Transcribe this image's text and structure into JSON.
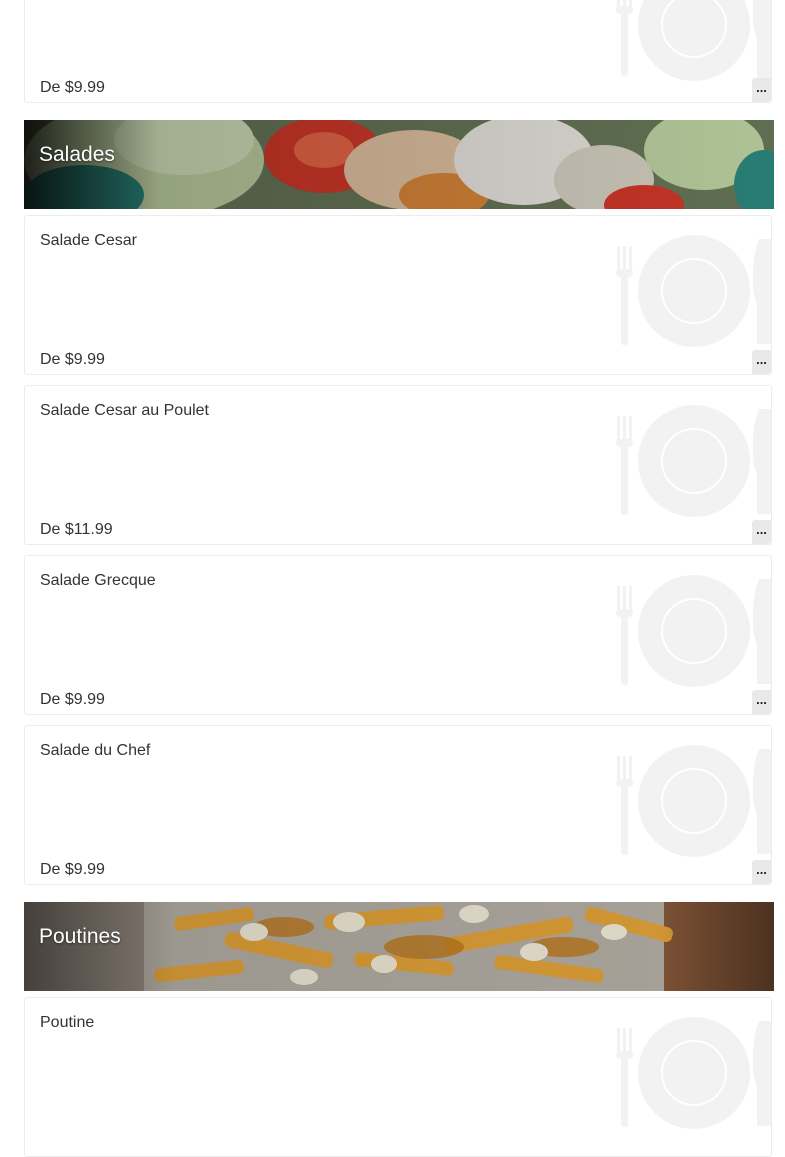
{
  "top_item": {
    "price": "De $9.99",
    "more_label": "..."
  },
  "sections": [
    {
      "title": "Salades",
      "items": [
        {
          "name": "Salade Cesar",
          "price": "De $9.99",
          "more_label": "..."
        },
        {
          "name": "Salade Cesar au Poulet",
          "price": "De $11.99",
          "more_label": "..."
        },
        {
          "name": "Salade Grecque",
          "price": "De $9.99",
          "more_label": "..."
        },
        {
          "name": "Salade du Chef",
          "price": "De $9.99",
          "more_label": "..."
        }
      ]
    },
    {
      "title": "Poutines",
      "items": [
        {
          "name": "Poutine",
          "price": "",
          "more_label": ""
        }
      ]
    }
  ],
  "icons": {
    "item_placeholder": "plate-fork-knife-icon",
    "more": "more-options-icon"
  }
}
